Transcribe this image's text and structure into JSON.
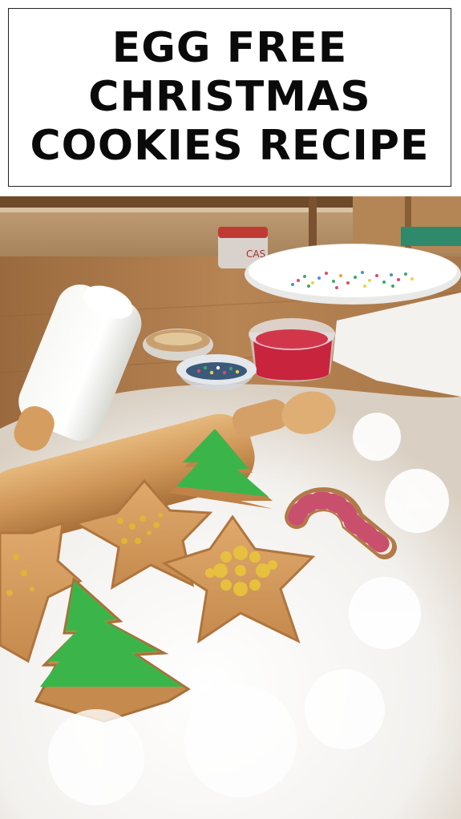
{
  "title": {
    "lines": [
      "EGG FREE",
      "CHRISTMAS",
      "COOKIES RECIPE"
    ]
  },
  "photo": {
    "jar_label": "CAS"
  }
}
